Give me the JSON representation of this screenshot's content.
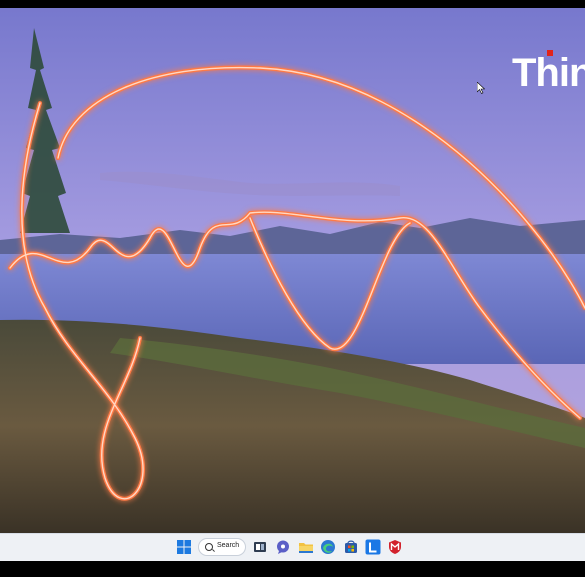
{
  "wallpaper": {
    "brand_text": "ThinkC",
    "accent_color": "#e2231a",
    "sky_color": "#8e8ad8",
    "lake_color": "#6f7fc7",
    "light_trail_color": "#ff6a35"
  },
  "taskbar": {
    "search_label": "Search",
    "icons": [
      {
        "name": "windows-start-icon",
        "color": "#1d7ae0"
      },
      {
        "name": "task-view-icon",
        "color": "#2f3d51"
      },
      {
        "name": "chat-icon",
        "color": "#5b5fc7"
      },
      {
        "name": "file-explorer-icon",
        "color": "#f2c242"
      },
      {
        "name": "edge-browser-icon",
        "color": "#2b78d1"
      },
      {
        "name": "store-icon",
        "color": "#2d5aa8"
      },
      {
        "name": "lenovo-vantage-icon",
        "color": "#1a78e5"
      },
      {
        "name": "mcafee-icon",
        "color": "#d2222c"
      }
    ]
  }
}
